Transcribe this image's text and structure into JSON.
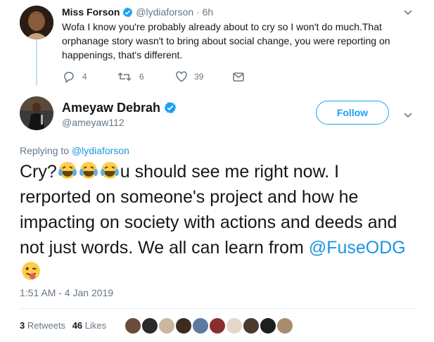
{
  "reply_tweet": {
    "author_name": "Miss Forson",
    "handle": "@lydiaforson",
    "separator": "·",
    "time": "6h",
    "text": "Wofa I know you're probably already about to cry so I won't do much.That orphanage story wasn't to bring about social change, you were reporting on happenings, that's different.",
    "reply_count": "4",
    "retweet_count": "6",
    "like_count": "39"
  },
  "main_tweet": {
    "author_name": "Ameyaw Debrah",
    "handle": "@ameyaw112",
    "follow_label": "Follow",
    "replying_prefix": "Replying to ",
    "replying_to": "@lydiaforson",
    "text_start": "Cry?",
    "text_rest": "u should see me right now. I rerported on someone's project and how he impacting on society with actions and deeds and not just words. We all can learn from ",
    "mention": "@FuseODG",
    "timestamp": "1:51 AM - 4 Jan 2019",
    "retweets_count": "3",
    "retweets_label": "Retweets",
    "likes_count": "46",
    "likes_label": "Likes"
  },
  "colors": {
    "accent": "#1da1f2",
    "link": "#1b95e0",
    "follow_text": "#1da1f2",
    "muted": "#657786",
    "verified": "#1da1f2"
  }
}
